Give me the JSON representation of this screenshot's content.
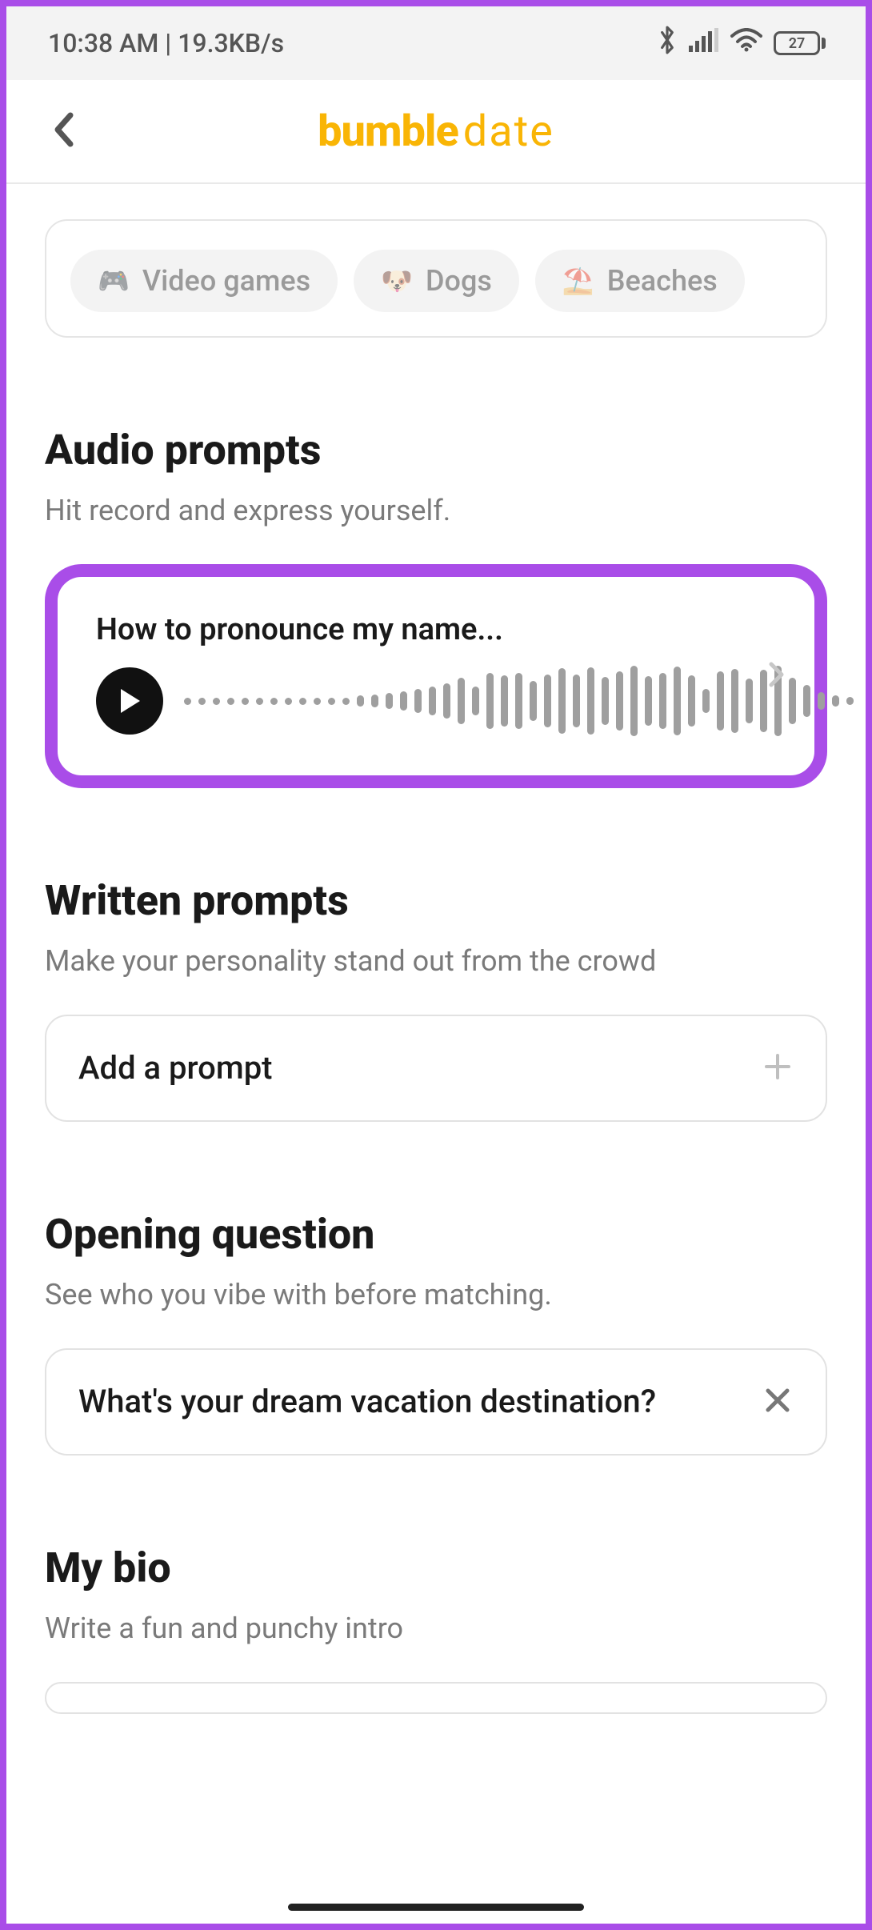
{
  "status": {
    "time": "10:38 AM",
    "sep": " | ",
    "net_speed": "19.3KB/s",
    "battery": "27"
  },
  "header": {
    "logo_bold": "bumble",
    "logo_light": "date"
  },
  "interests": {
    "items": [
      {
        "icon": "🎮",
        "label": "Video games"
      },
      {
        "icon": "🐶",
        "label": "Dogs"
      },
      {
        "icon": "⛱️",
        "label": "Beaches"
      }
    ]
  },
  "audio": {
    "heading": "Audio prompts",
    "sub": "Hit record and express yourself.",
    "prompt_title": "How to pronounce my name..."
  },
  "written": {
    "heading": "Written prompts",
    "sub": "Make your personality stand out from the crowd",
    "add_label": "Add a prompt"
  },
  "opening": {
    "heading": "Opening question",
    "sub": "See who you vibe with before matching.",
    "question": "What's your dream vacation destination?"
  },
  "bio": {
    "heading": "My bio",
    "sub": "Write a fun and punchy intro"
  }
}
